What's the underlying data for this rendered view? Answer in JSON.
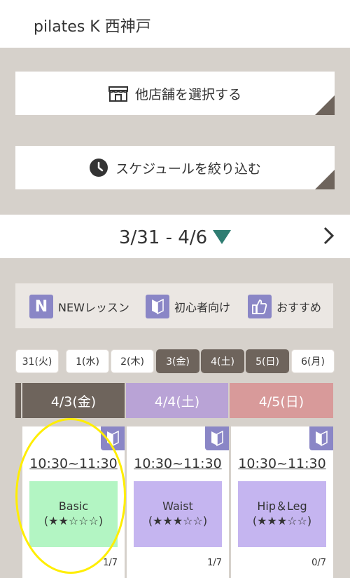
{
  "header": {
    "title": "pilates K 西神戸"
  },
  "actions": {
    "store_label": "他店舗を選択する",
    "filter_label": "スケジュールを絞り込む"
  },
  "week": {
    "range": "3/31 - 4/6"
  },
  "legend": {
    "new_label": "NEWレッスン",
    "new_icon_letter": "N",
    "beginner_label": "初心者向け",
    "recommend_label": "おすすめ"
  },
  "days": [
    "31(火)",
    "1(水)",
    "2(木)",
    "3(金)",
    "4(土)",
    "5(日)",
    "6(月)"
  ],
  "date_headers": [
    "4/3(金)",
    "4/4(土)",
    "4/5(日)"
  ],
  "cards": [
    {
      "time": "10:30~11:30",
      "name": "Basic",
      "level": "(★★☆☆☆)",
      "count": "1/7",
      "color": "#b3f5c3"
    },
    {
      "time": "10:30~11:30",
      "name": "Waist",
      "level": "(★★★☆☆)",
      "count": "1/7",
      "color": "#c5b5f0"
    },
    {
      "time": "10:30~11:30",
      "name": "Hip＆Leg",
      "level": "(★★★☆☆)",
      "count": "0/7",
      "color": "#c5b5f0"
    }
  ],
  "colors": {
    "accent_dark": "#6e645c",
    "saturday": "#b9a3d6",
    "sunday": "#d89a9a",
    "icon_purple": "#8a86c6",
    "triangle_teal": "#2f7d72"
  }
}
